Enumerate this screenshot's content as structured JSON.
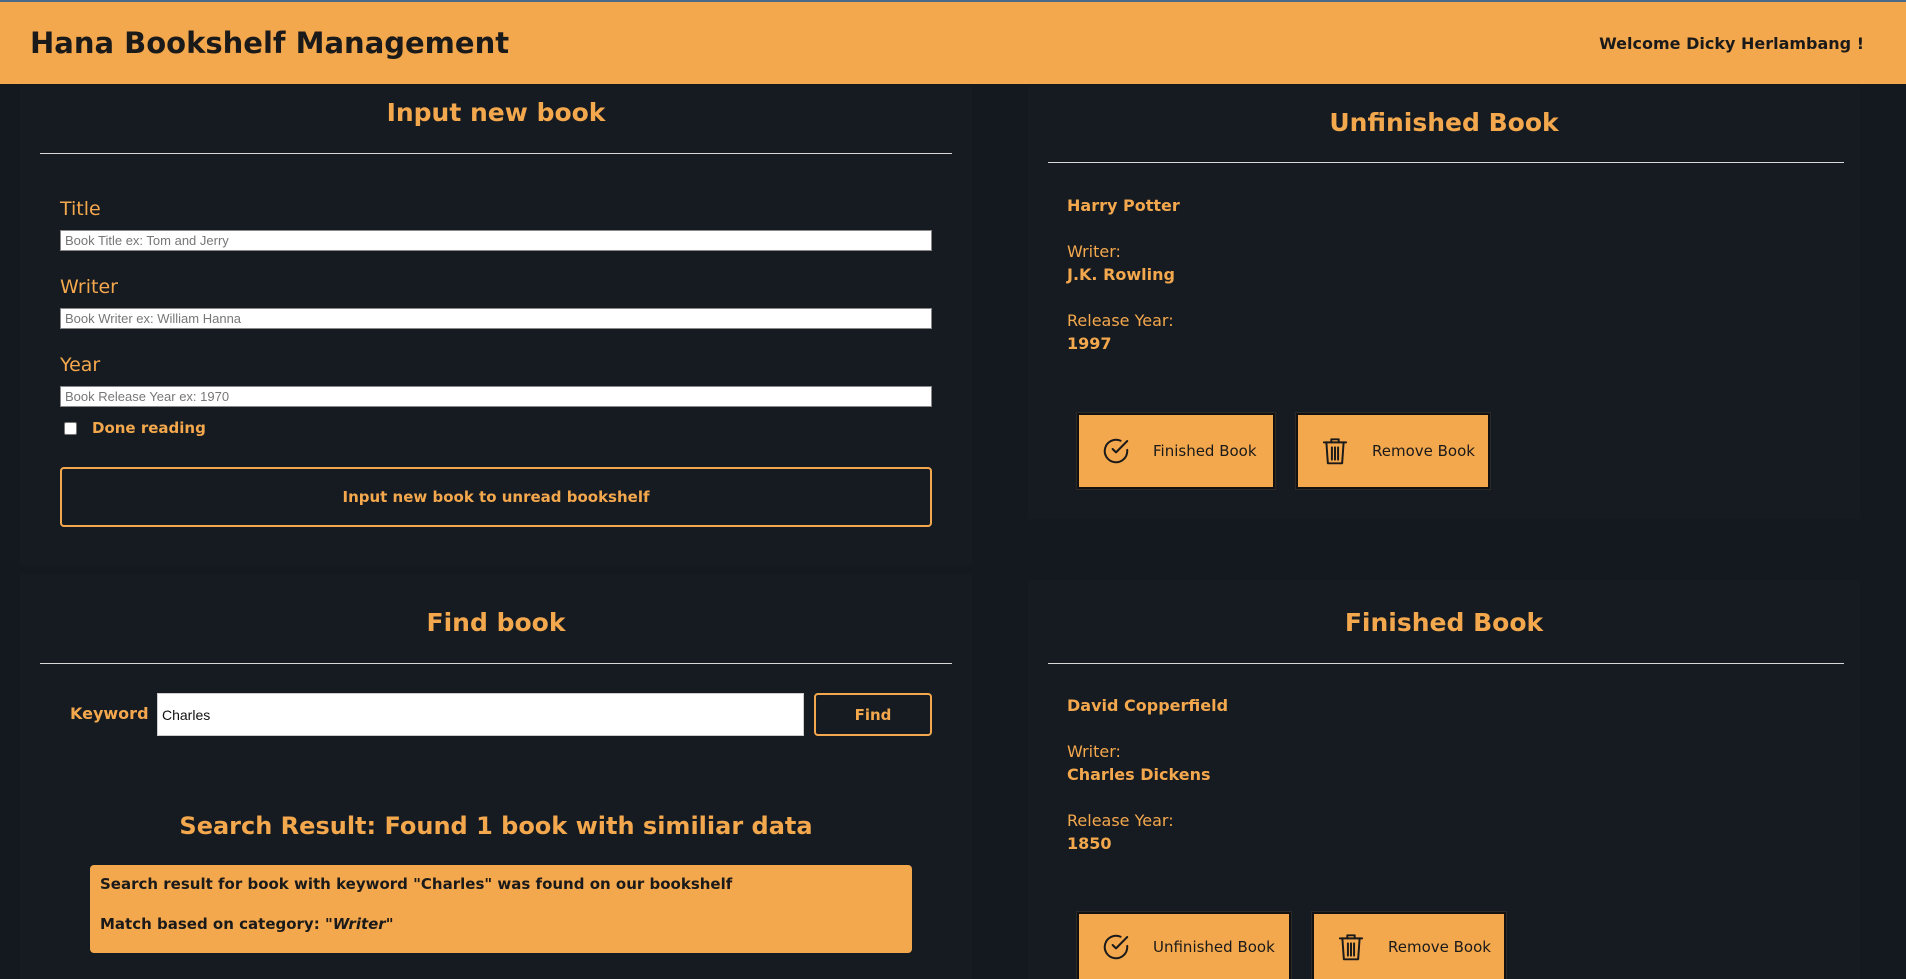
{
  "header": {
    "title": "Hana Bookshelf Management",
    "welcome": "Welcome Dicky Herlambang !"
  },
  "input_form": {
    "heading": "Input new book",
    "title_label": "Title",
    "title_placeholder": "Book Title ex: Tom and Jerry",
    "writer_label": "Writer",
    "writer_placeholder": "Book Writer ex: William Hanna",
    "year_label": "Year",
    "year_placeholder": "Book Release Year ex: 1970",
    "done_label": "Done reading",
    "submit_label": "Input new book to unread bookshelf"
  },
  "find": {
    "heading": "Find book",
    "keyword_label": "Keyword",
    "keyword_value": "Charles",
    "find_label": "Find",
    "result_title": "Search Result: Found 1 book with similiar data",
    "result_line1": "Search result for book with keyword \"Charles\" was found on our bookshelf",
    "result_line2_prefix": "Match based on category: ",
    "result_line2_category": "\"Writer\""
  },
  "unfinished": {
    "heading": "Unfinished Book",
    "books": [
      {
        "title": "Harry Potter",
        "writer_label": "Writer:",
        "writer": "J.K. Rowling",
        "year_label": "Release Year:",
        "year": "1997",
        "primary_action": "Finished Book",
        "remove_action": "Remove Book"
      }
    ]
  },
  "finished": {
    "heading": "Finished Book",
    "books": [
      {
        "title": "David Copperfield",
        "writer_label": "Writer:",
        "writer": "Charles Dickens",
        "year_label": "Release Year:",
        "year": "1850",
        "primary_action": "Unfinished Book",
        "remove_action": "Remove Book"
      }
    ]
  },
  "icons": {
    "check": "check-circle-icon",
    "trash": "trash-icon"
  },
  "colors": {
    "accent": "#f4a84d",
    "background": "#14191f",
    "panel": "#161b21"
  }
}
